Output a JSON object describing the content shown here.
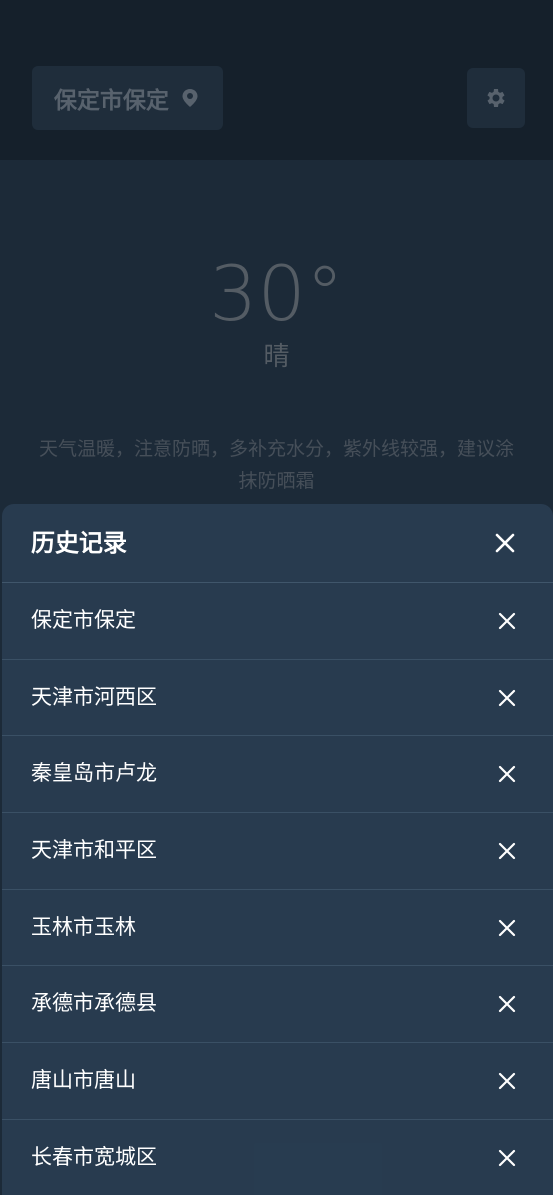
{
  "header": {
    "location": "保定市保定",
    "location_icon": "map-pin-icon",
    "settings_icon": "gear-icon"
  },
  "current": {
    "temperature": "30°",
    "condition": "晴",
    "advice": "天气温暖，注意防晒，多补充水分，紫外线较强，建议涂抹防晒霜"
  },
  "history": {
    "title": "历史记录",
    "close_icon": "close-icon",
    "items": [
      {
        "label": "保定市保定"
      },
      {
        "label": "天津市河西区"
      },
      {
        "label": "秦皇岛市卢龙"
      },
      {
        "label": "天津市和平区"
      },
      {
        "label": "玉林市玉林"
      },
      {
        "label": "承德市承德县"
      },
      {
        "label": "唐山市唐山"
      },
      {
        "label": "长春市宽城区"
      }
    ]
  },
  "colors": {
    "page_background": "#1c2a38",
    "topbar": "#15202b",
    "sheet_background": "#293d51",
    "text_primary": "#ffffff",
    "text_dimmed": "#545c64"
  }
}
